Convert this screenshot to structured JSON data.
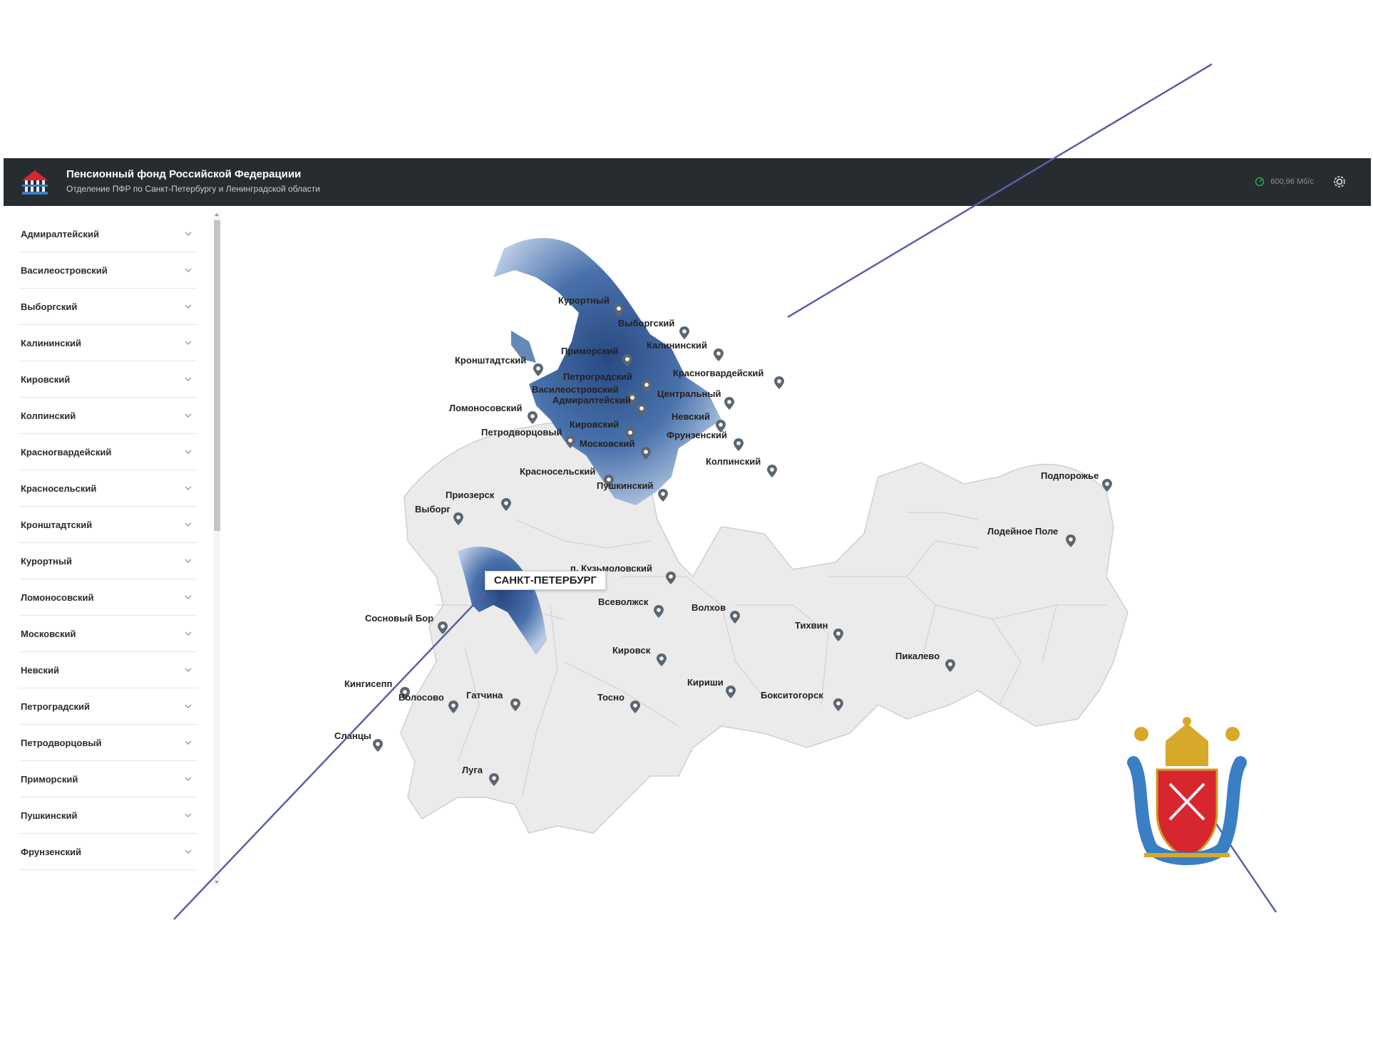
{
  "header": {
    "title": "Пенсионный фонд Российской Федерациии",
    "subtitle": "Отделение ПФР по Санкт-Петербургу и Ленинградской области",
    "speed": "600,96 Мб/с"
  },
  "sidebar": {
    "items": [
      {
        "label": "Адмиралтейский"
      },
      {
        "label": "Василеостровский"
      },
      {
        "label": "Выборгский"
      },
      {
        "label": "Калининский"
      },
      {
        "label": "Кировский"
      },
      {
        "label": "Колпинский"
      },
      {
        "label": "Красногвардейский"
      },
      {
        "label": "Красносельский"
      },
      {
        "label": "Кронштадтский"
      },
      {
        "label": "Курортный"
      },
      {
        "label": "Ломоносовский"
      },
      {
        "label": "Московский"
      },
      {
        "label": "Невский"
      },
      {
        "label": "Петроградский"
      },
      {
        "label": "Петродворцовый"
      },
      {
        "label": "Приморский"
      },
      {
        "label": "Пушкинский"
      },
      {
        "label": "Фрунзенский"
      }
    ]
  },
  "map": {
    "city_label": "САНКТ-ПЕТЕРБУРГ",
    "spb_districts": [
      {
        "name": "Курортный"
      },
      {
        "name": "Выборгский"
      },
      {
        "name": "Приморский"
      },
      {
        "name": "Калининский"
      },
      {
        "name": "Кронштадтский"
      },
      {
        "name": "Петроградский"
      },
      {
        "name": "Красногвардейский"
      },
      {
        "name": "Василеостровский"
      },
      {
        "name": "Центральный"
      },
      {
        "name": "Адмиралтейский"
      },
      {
        "name": "Ломоносовский"
      },
      {
        "name": "Невский"
      },
      {
        "name": "Кировский"
      },
      {
        "name": "Петродворцовый"
      },
      {
        "name": "Фрунзенский"
      },
      {
        "name": "Московский"
      },
      {
        "name": "Колпинский"
      },
      {
        "name": "Красносельский"
      },
      {
        "name": "Пушкинский"
      }
    ],
    "oblast_places": [
      {
        "name": "Подпорожье"
      },
      {
        "name": "Приозерск"
      },
      {
        "name": "Выборг"
      },
      {
        "name": "Лодейное Поле"
      },
      {
        "name": "п. Кузьмоловский"
      },
      {
        "name": "Всеволжск"
      },
      {
        "name": "Волхов"
      },
      {
        "name": "Сосновый Бор"
      },
      {
        "name": "Тихвин"
      },
      {
        "name": "Кировск"
      },
      {
        "name": "Пикалево"
      },
      {
        "name": "Кингисепп"
      },
      {
        "name": "Кириши"
      },
      {
        "name": "Волосово"
      },
      {
        "name": "Гатчина"
      },
      {
        "name": "Тосно"
      },
      {
        "name": "Бокситогорск"
      },
      {
        "name": "Сланцы"
      },
      {
        "name": "Луга"
      }
    ]
  },
  "colors": {
    "header_bg": "#272c31",
    "region_fill": "#ebebeb",
    "spb_blue": "#3f6aa8",
    "line": "#5b5fa8",
    "coat_red": "#d8262f",
    "coat_blue": "#3a7fc4",
    "coat_gold": "#d7a92a"
  },
  "icons": [
    "pfr-logo-icon",
    "speedometer-icon",
    "gear-icon",
    "chevron-down-icon",
    "map-pin-icon",
    "coat-of-arms-icon"
  ]
}
